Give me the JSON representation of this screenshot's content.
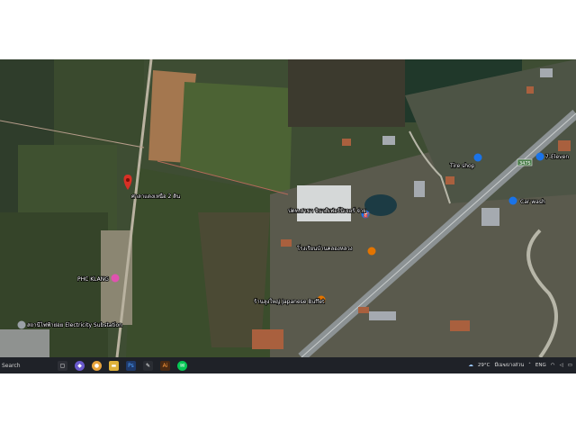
{
  "map": {
    "pins": [
      {
        "label": "ศาลาแดงเหนือ 2 ดิน",
        "color": "#d93025",
        "type": "red-pin"
      },
      {
        "label": "ปตท.สาขา จินาติเฟอร์นิเจอร์ จ่าย",
        "color": "#1a73e8"
      },
      {
        "label": "โรงเรียนบ้านคลองหลวง",
        "color": "#e37400"
      },
      {
        "label": "ร้านลุงใหญ่ Japanese Buffet",
        "color": "#e37400"
      },
      {
        "label": "PHC KLANG",
        "color": "#e052b0"
      },
      {
        "label": "สถานีไฟฟ้าย่อย Electricity Substation",
        "color": "#9aa0a6"
      },
      {
        "label": "7-Eleven",
        "color": "#1a73e8"
      },
      {
        "label": "Car wash",
        "color": "#1a73e8"
      },
      {
        "label": "Tire shop",
        "color": "#1a73e8"
      }
    ],
    "road_shield": "3475"
  },
  "taskbar": {
    "search": "Search",
    "weather": "29°C",
    "weather_desc": "มีเมฆบางส่วน",
    "time": "",
    "language": "ENG"
  },
  "colors": {
    "pin_red": "#d93025",
    "road": "#9aa0a6",
    "taskbar": "#1f2228"
  }
}
